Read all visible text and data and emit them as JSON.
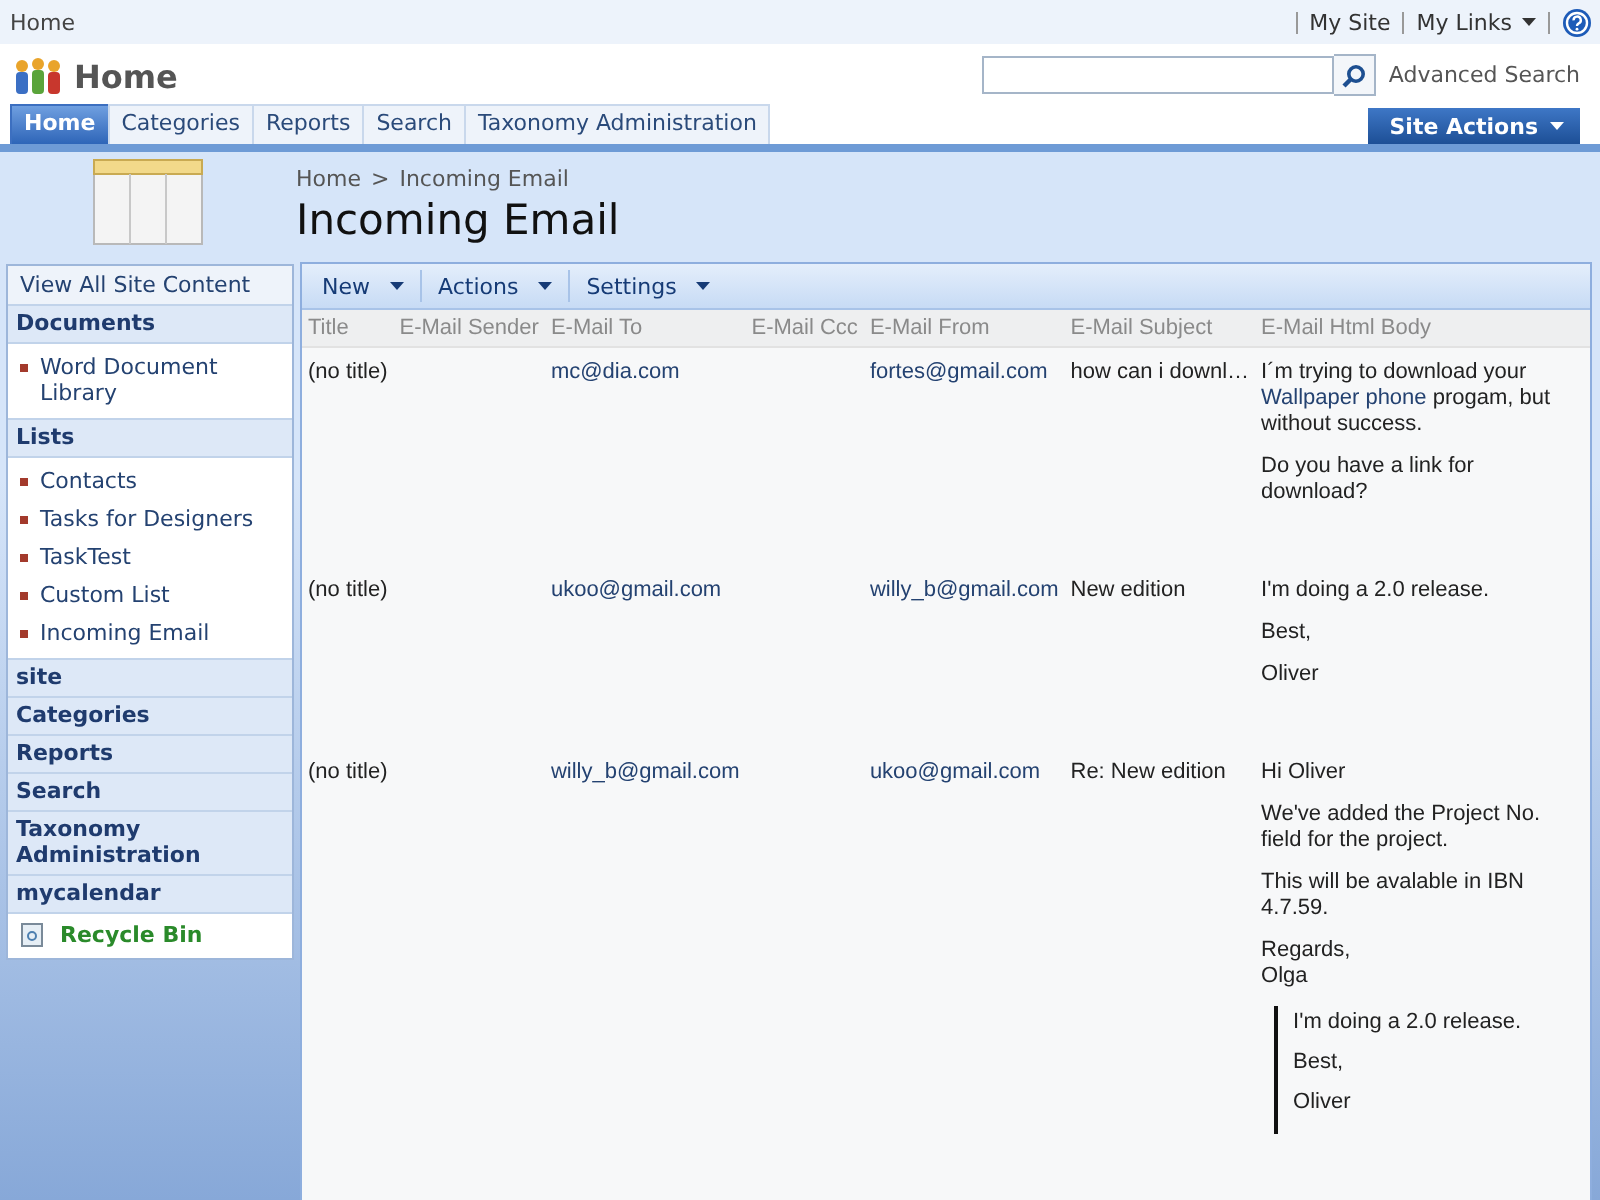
{
  "top_bar": {
    "breadcrumb": "Home",
    "links": [
      {
        "label": "My Site",
        "dropdown": false
      },
      {
        "label": "My Links",
        "dropdown": true
      }
    ]
  },
  "header": {
    "site_title": "Home",
    "advanced_search": "Advanced Search",
    "site_actions": "Site Actions"
  },
  "tabs": [
    {
      "label": "Home",
      "selected": true
    },
    {
      "label": "Categories",
      "selected": false
    },
    {
      "label": "Reports",
      "selected": false
    },
    {
      "label": "Search",
      "selected": false
    },
    {
      "label": "Taxonomy Administration",
      "selected": false
    }
  ],
  "page": {
    "breadcrumb": [
      "Home",
      "Incoming Email"
    ],
    "separator": ">",
    "title": "Incoming Email"
  },
  "sidebar": {
    "view_all": "View All Site Content",
    "sections": [
      {
        "heading": "Documents",
        "items": [
          "Word Document Library"
        ]
      },
      {
        "heading": "Lists",
        "items": [
          "Contacts",
          "Tasks for Designers",
          "TaskTest",
          "Custom List",
          "Incoming Email"
        ]
      },
      {
        "heading": "site"
      },
      {
        "heading": "Categories"
      },
      {
        "heading": "Reports"
      },
      {
        "heading": "Search"
      },
      {
        "heading": "Taxonomy Administration"
      },
      {
        "heading": "mycalendar"
      }
    ],
    "recycle_bin": "Recycle Bin"
  },
  "toolbar": [
    {
      "label": "New"
    },
    {
      "label": "Actions"
    },
    {
      "label": "Settings"
    }
  ],
  "table": {
    "columns": [
      "Title",
      "E-Mail Sender",
      "E-Mail To",
      "E-Mail Ccc",
      "E-Mail From",
      "E-Mail Subject",
      "E-Mail Html Body"
    ],
    "rows": [
      {
        "title": "(no title)",
        "to": "mc@dia.com",
        "from": "fortes@gmail.com",
        "subject": "how can i downl…",
        "body": [
          {
            "kind": "link-text",
            "before": "I´m trying to download your ",
            "link": "Wallpaper phone",
            "after": " progam, but without success."
          },
          {
            "kind": "text",
            "lines": [
              "Do you have a link for download?"
            ]
          }
        ]
      },
      {
        "title": "(no title)",
        "to": "ukoo@gmail.com",
        "from": "willy_b@gmail.com",
        "subject": "New edition",
        "body": [
          {
            "kind": "text",
            "lines": [
              "I'm doing a 2.0 release."
            ]
          },
          {
            "kind": "text",
            "lines": [
              "Best,"
            ]
          },
          {
            "kind": "text",
            "lines": [
              "Oliver"
            ]
          }
        ]
      },
      {
        "title": "(no title)",
        "to": "willy_b@gmail.com",
        "from": "ukoo@gmail.com",
        "subject": "Re: New edition",
        "body": [
          {
            "kind": "text",
            "lines": [
              "Hi Oliver"
            ]
          },
          {
            "kind": "text",
            "lines": [
              "We've added the Project No. field for the project."
            ]
          },
          {
            "kind": "text",
            "lines": [
              "This will be avalable in IBN 4.7.59."
            ]
          },
          {
            "kind": "text",
            "lines": [
              "Regards,",
              "Olga"
            ]
          },
          {
            "kind": "quote",
            "lines": [
              "I'm doing a 2.0 release.",
              "Best,",
              "Oliver"
            ]
          }
        ]
      }
    ]
  }
}
